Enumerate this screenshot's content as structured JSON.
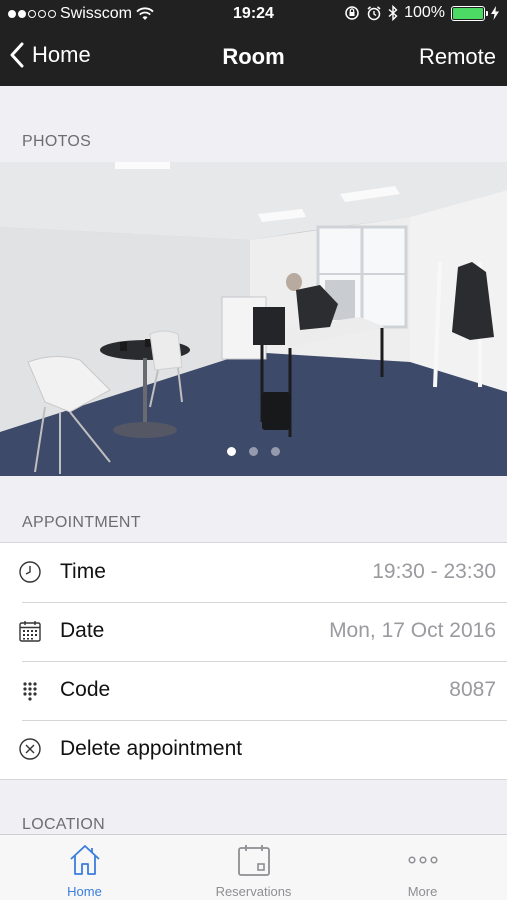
{
  "status": {
    "carrier": "Swisscom",
    "time": "19:24",
    "battery": "100%"
  },
  "nav": {
    "back_label": "Home",
    "title": "Room",
    "right_label": "Remote"
  },
  "sections": {
    "photos": "PHOTOS",
    "appointment": "APPOINTMENT",
    "location": "LOCATION"
  },
  "photo_pager": {
    "count": 3,
    "active": 1
  },
  "appointment": {
    "time_label": "Time",
    "time_value": "19:30 - 23:30",
    "date_label": "Date",
    "date_value": "Mon, 17 Oct 2016",
    "code_label": "Code",
    "code_value": "8087",
    "delete_label": "Delete appointment"
  },
  "tabs": [
    {
      "label": "Home",
      "icon": "house-icon",
      "active": true
    },
    {
      "label": "Reservations",
      "icon": "calendar-icon",
      "active": false
    },
    {
      "label": "More",
      "icon": "more-dots-icon",
      "active": false
    }
  ],
  "colors": {
    "accent": "#3b7ddd",
    "topbar": "#212121",
    "battery": "#4cd964",
    "background": "#efeff4"
  }
}
